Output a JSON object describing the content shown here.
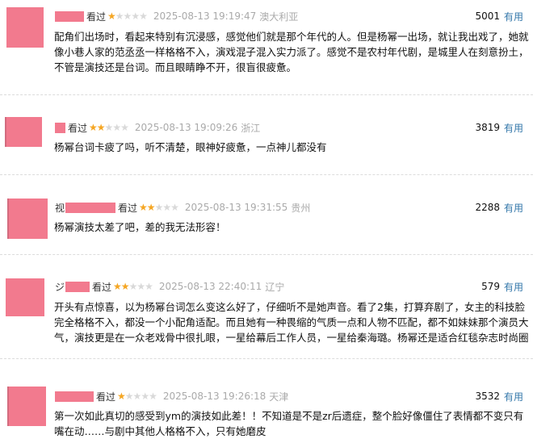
{
  "rating_label": "看过",
  "useful_label": "有用",
  "colors": {
    "avatar": "#f27a8e",
    "star_on": "#f5a623",
    "star_off": "#d9d9d9",
    "link": "#3377aa",
    "muted": "#aaaaaa"
  },
  "comments": [
    {
      "name_fragment": "",
      "stars": 1,
      "time": "2025-08-13 19:19:47",
      "location": "澳大利亚",
      "votes": "5001",
      "text": "配角们出场时，看起来特别有沉浸感，感觉他们就是那个年代的人。但是杨幂一出场，就让我出戏了，她就像小巷人家的范丞丞一样格格不入，演戏混子混入实力派了。感觉不是农村年代剧，是城里人在刻意扮土，不管是演技还是台词。而且眼睛睁不开，很盲很疲惫。"
    },
    {
      "name_fragment": "",
      "stars": 2,
      "time": "2025-08-13 19:09:26",
      "location": "浙江",
      "votes": "3819",
      "text": "杨幂台词卡疲了吗，听不清楚，眼神好疲惫，一点神儿都没有"
    },
    {
      "name_fragment": "视",
      "stars": 2,
      "time": "2025-08-13 19:31:55",
      "location": "贵州",
      "votes": "2288",
      "text": "杨幂演技太差了吧，差的我无法形容！"
    },
    {
      "name_fragment": "ジ",
      "stars": 2,
      "time": "2025-08-13 22:40:11",
      "location": "辽宁",
      "votes": "579",
      "text": "开头有点惊喜，以为杨幂台词怎么变这么好了，仔细听不是她声音。看了2集，打算弃剧了，女主的科技脸完全格格不入，都没一个小配角适配。而且她有一种畏缩的气质一点和人物不匹配，都不如妹妹那个演员大气，演技更是在一众老戏骨中很扎眼，一星给幕后工作人员，一星给秦海璐。杨幂还是适合红毯杂志时尚圈"
    },
    {
      "name_fragment": "",
      "stars": 1,
      "time": "2025-08-13 19:26:18",
      "location": "天津",
      "votes": "3532",
      "text": "第一次如此真切的感受到ym的演技如此差！！不知道是不是zr后遗症，整个脸好像僵住了表情都不变只有嘴在动……与剧中其他人格格不入，只有她磨皮"
    }
  ]
}
